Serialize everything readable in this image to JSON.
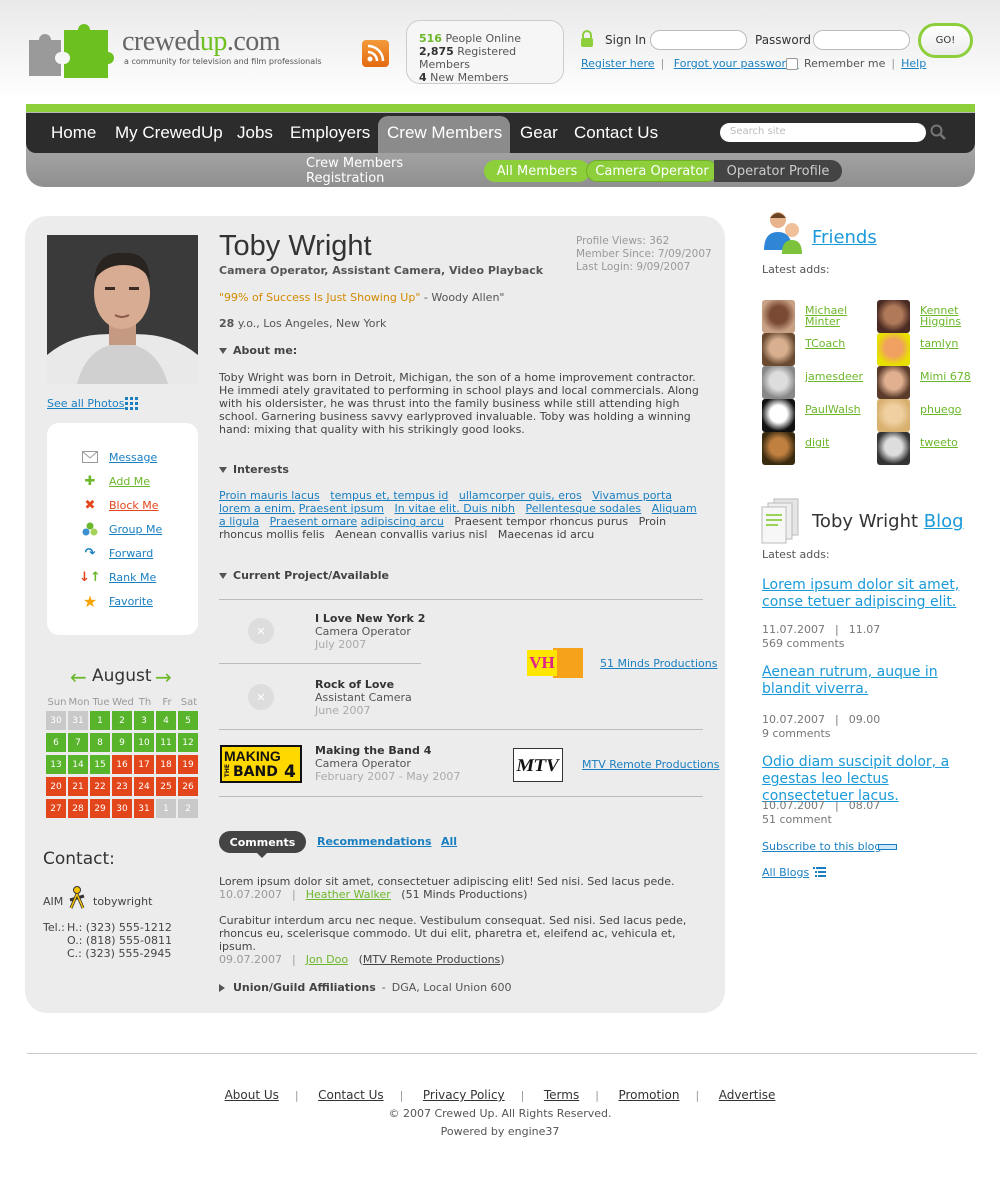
{
  "header": {
    "logo_main": "crewed",
    "logo_accent": "up",
    "logo_tld": ".com",
    "tagline": "a community for television and film professionals",
    "stats": {
      "online_count": "516",
      "online_label": "People Online",
      "registered_count": "2,875",
      "registered_label": "Registered Members",
      "new_count": "4",
      "new_label": "New Members"
    },
    "signin_label": "Sign In",
    "password_label": "Password",
    "go_label": "GO!",
    "register_link": "Register here",
    "forgot_link": "Forgot your password?",
    "remember_label": "Remember me",
    "help_link": "Help"
  },
  "nav": {
    "items": [
      "Home",
      "My CrewedUp",
      "Jobs",
      "Employers",
      "Crew Members",
      "Gear",
      "Contact Us"
    ],
    "search_placeholder": "Search site",
    "subnav": [
      "Crew Members Registration",
      "All Members",
      "Camera Operator",
      "Operator  Profile"
    ]
  },
  "profile": {
    "see_photos": "See all Photos",
    "name": "Toby Wright",
    "roles": "Camera Operator, Assistant Camera, Video Playback",
    "quote": "\"99% of Success Is Just Showing Up\"",
    "quote_author": "- Woody Allen\"",
    "age": "28",
    "age_suffix": "y.o., Los Angeles, New York",
    "views": "Profile Views: 362",
    "member_since": "Member Since: 7/09/2007",
    "last_login": "Last Login: 9/09/2007",
    "about_title": "About me:",
    "about_text": "Toby Wright was born in Detroit, Michigan, the son of a home improvement contractor. He immedi ately gravitated to performing in school plays and local commercials. Along with his oldersister, he was thrust into the family business while still attending high school. Garnering business savvy earlyproved invaluable. Toby was holding a winning hand: mixing that quality with his strikingly good looks.",
    "interests_title": "Interests",
    "interests_links": [
      "Proin mauris lacus",
      "tempus et, tempus id",
      "ullamcorper quis, eros",
      "Vivamus porta lorem a enim.",
      "Praesent ipsum",
      "In vitae elit. Duis nibh",
      "Pellentesque sodales",
      "Aliquam a ligula",
      "Praesent ornare",
      "adipiscing arcu"
    ],
    "interests_plain": [
      "Praesent tempor rhoncus purus",
      "Proin rhoncus mollis felis",
      "Aenean convallis",
      "varius nisl",
      "Maecenas id arcu"
    ],
    "project_title": "Current Project/Available",
    "projects": [
      {
        "title": "I Love New York 2",
        "role": "Camera Operator",
        "date": "July 2007"
      },
      {
        "title": "Rock of Love",
        "role": "Assistant Camera",
        "date": "June 2007"
      },
      {
        "title": "Making the Band 4",
        "role": "Camera Operator",
        "date": "February 2007 - May 2007"
      }
    ],
    "company1": "51 Minds Productions",
    "company2": "MTV Remote Productions",
    "logo_vh1": "VH",
    "logo_making_top": "MAKING",
    "logo_making_the": "THE",
    "logo_making_band": "BAND",
    "logo_making_num": "4",
    "logo_mtv": "MTV",
    "tabs": [
      "Comments",
      "Recommendations",
      "All"
    ],
    "comments": [
      {
        "text": "Lorem ipsum dolor sit amet, consectetuer adipiscing elit! Sed nisi. Sed lacus pede.",
        "date": "10.07.2007",
        "author": "Heather Walker",
        "org": "(51 Minds Productions)"
      },
      {
        "text": "Curabitur interdum arcu nec neque. Vestibulum consequat. Sed nisi. Sed lacus pede, rhoncus eu, scelerisque commodo. Ut dui elit, pharetra et, eleifend ac, vehicula et, ipsum.",
        "date": "09.07.2007",
        "author": "Jon Doo",
        "org": "MTV Remote Productions"
      }
    ],
    "union_title": "Union/Guild Affiliations",
    "union_value": "DGA, Local Union 600"
  },
  "actions": [
    "Message",
    "Add Me",
    "Block Me",
    "Group Me",
    "Forward",
    "Rank Me",
    "Favorite"
  ],
  "calendar": {
    "month": "August",
    "days": [
      "Sun",
      "Mon",
      "Tue",
      "Wed",
      "Th",
      "Fr",
      "Sat"
    ],
    "weeks": [
      [
        "30",
        "31",
        "1",
        "2",
        "3",
        "4",
        "5"
      ],
      [
        "6",
        "7",
        "8",
        "9",
        "10",
        "11",
        "12"
      ],
      [
        "13",
        "14",
        "15",
        "16",
        "17",
        "18",
        "19"
      ],
      [
        "20",
        "21",
        "22",
        "23",
        "24",
        "25",
        "26"
      ],
      [
        "27",
        "28",
        "29",
        "30",
        "31",
        "1",
        "2"
      ]
    ],
    "colors": {
      "green": "#58b42a",
      "red": "#e4461b",
      "gray": "#c9c9c9"
    }
  },
  "contact": {
    "title": "Contact:",
    "aim_label": "AIM",
    "aim_name": "tobywright",
    "tel_label": "Tel.:",
    "home": "H.: (323) 555-1212",
    "office": "O.: (818) 555-0811",
    "cell": "C.:  (323) 555-2945"
  },
  "friends": {
    "title": "Friends",
    "latest": "Latest adds:",
    "list": [
      "Michael Minter",
      "Kennet Higgins",
      "TCoach",
      "tamlyn",
      "jamesdeer",
      "Mimi 678",
      "PaulWalsh",
      "phuego",
      "digit",
      "tweeto"
    ]
  },
  "blog": {
    "title_name": "Toby Wright",
    "title_link": "Blog",
    "latest": "Latest adds:",
    "posts": [
      {
        "title": "Lorem ipsum dolor sit amet, conse tetuer adipiscing elit.",
        "date": "11.07.2007",
        "time": "11.07",
        "comments": "569 comments"
      },
      {
        "title": "Aenean rutrum, auque in blandit viverra.",
        "date": "10.07.2007",
        "time": "09.00",
        "comments": "9 comments"
      },
      {
        "title": "Odio diam suscipit dolor, a egestas leo lectus consectetuer lacus.",
        "date": "10.07.2007",
        "time": "08.07",
        "comments": "51 comment"
      }
    ],
    "subscribe": "Subscribe to this blog",
    "all_blogs": "All Blogs"
  },
  "footer": {
    "links": [
      "About Us",
      "Contact Us",
      "Privacy Policy",
      "Terms",
      "Promotion",
      "Advertise"
    ],
    "copyright": "© 2007 Crewed Up. All Rights Reserved.",
    "powered": "Powered by engine37"
  },
  "colors": {
    "accent_green": "#8ccf3b",
    "link_blue": "#1a7fc1",
    "nav_dark": "#2c2c2c"
  }
}
